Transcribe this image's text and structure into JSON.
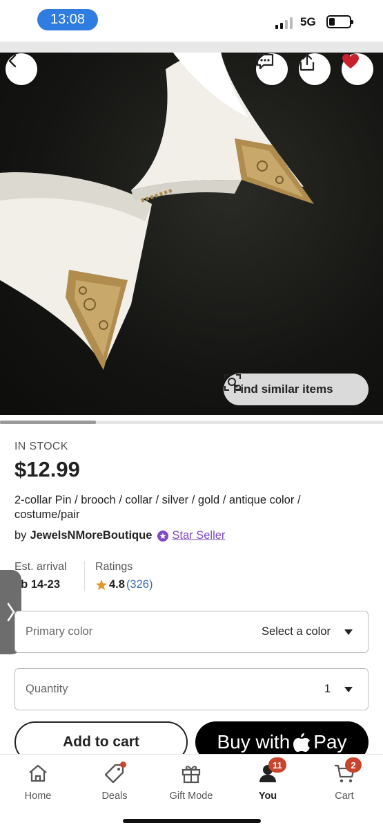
{
  "status_bar": {
    "time": "13:08",
    "network": "5G"
  },
  "hero": {
    "find_similar_label": "Find similar items",
    "image_progress": 0.25
  },
  "product": {
    "stock_status": "IN STOCK",
    "price": "$12.99",
    "title": "2-collar Pin / brooch / collar / silver / gold / antique color / costume/pair",
    "seller_prefix": "by",
    "seller_name": "JewelsNMoreBoutique",
    "seller_badge": "Star Seller",
    "arrival_label": "Est. arrival",
    "arrival_value": "eb 14-23",
    "ratings_label": "Ratings",
    "rating": "4.8",
    "rating_count": "(326)"
  },
  "options": {
    "color_label": "Primary color",
    "color_value": "Select a color",
    "quantity_label": "Quantity",
    "quantity_value": "1"
  },
  "actions": {
    "add_to_cart": "Add to cart",
    "buy_with": "Buy with",
    "pay": "Pay"
  },
  "nav": {
    "items": [
      {
        "label": "Home"
      },
      {
        "label": "Deals"
      },
      {
        "label": "Gift Mode"
      },
      {
        "label": "You",
        "badge": "11"
      },
      {
        "label": "Cart",
        "badge": "2"
      }
    ]
  },
  "colors": {
    "accent": "#c8442c",
    "star_seller": "#7d4bc4",
    "link": "#3b6bb5"
  }
}
